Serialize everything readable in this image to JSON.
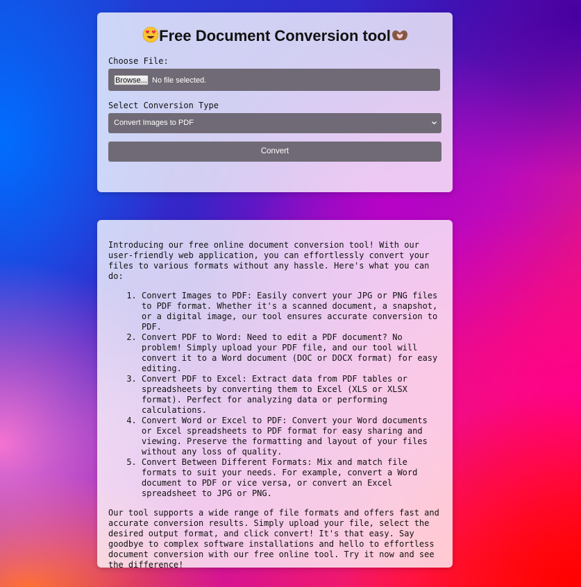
{
  "converter": {
    "title": "Free Document Conversion tool",
    "title_icon_left": "star-struck-face-emoji",
    "title_icon_right": "heart-hands-emoji",
    "file_label": "Choose File:",
    "browse_label": "Browse...",
    "file_status": "No file selected.",
    "type_label": "Select Conversion Type",
    "selected_type": "Convert Images to PDF",
    "convert_label": "Convert"
  },
  "info": {
    "intro": "Introducing our free online document conversion tool! With our user-friendly web application, you can effortlessly convert your files to various formats without any hassle. Here's what you can do:",
    "features": [
      "Convert Images to PDF: Easily convert your JPG or PNG files to PDF format. Whether it's a scanned document, a snapshot, or a digital image, our tool ensures accurate conversion to PDF.",
      "Convert PDF to Word: Need to edit a PDF document? No problem! Simply upload your PDF file, and our tool will convert it to a Word document (DOC or DOCX format) for easy editing.",
      "Convert PDF to Excel: Extract data from PDF tables or spreadsheets by converting them to Excel (XLS or XLSX format). Perfect for analyzing data or performing calculations.",
      "Convert Word or Excel to PDF: Convert your Word documents or Excel spreadsheets to PDF format for easy sharing and viewing. Preserve the formatting and layout of your files without any loss of quality.",
      "Convert Between Different Formats: Mix and match file formats to suit your needs. For example, convert a Word document to PDF or vice versa, or convert an Excel spreadsheet to JPG or PNG."
    ],
    "outro": "Our tool supports a wide range of file formats and offers fast and accurate conversion results. Simply upload your file, select the desired output format, and click convert! It's that easy. Say goodbye to complex software installations and hello to effortless document conversion with our free online tool. Try it now and see the difference!"
  },
  "colors": {
    "control_bg": "#6f6a75",
    "card_bg": "rgba(255,255,255,0.78)"
  }
}
